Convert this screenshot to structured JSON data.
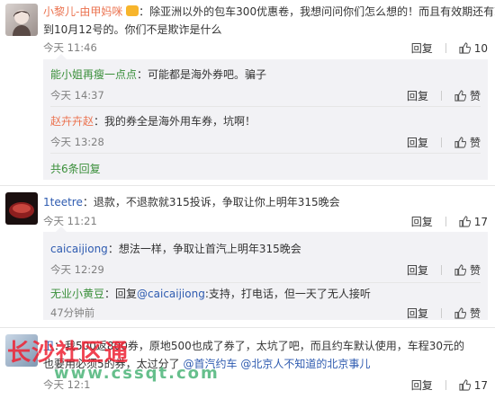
{
  "comments": [
    {
      "name": "小黎儿-由甲妈咪",
      "text_a": "：除亚洲以外的包车300优惠卷，我想问问你们怎么想的！而且有效期还有就",
      "text_b": "到10月12号的。你们不是欺诈是什么",
      "time": "今天 11:46",
      "reply_label": "回复",
      "likes": "10",
      "replies": [
        {
          "name": "能小姐再瘦一点点",
          "text": "：可能都是海外券吧。骗子",
          "time": "今天 14:37",
          "reply_label": "回复",
          "like_label": "赞"
        },
        {
          "name": "赵卉卉赵",
          "text": "：我的券全是海外用车券，坑啊！",
          "time": "今天 13:28",
          "reply_label": "回复",
          "like_label": "赞"
        }
      ],
      "more": "共6条回复"
    },
    {
      "name": "1teetre",
      "text": "：退款，不退款就315投诉，争取让你上明年315晚会",
      "time": "今天 11:21",
      "reply_label": "回复",
      "likes": "17",
      "replies": [
        {
          "name": "caicaijiong",
          "text": "：想法一样，争取让首汽上明年315晚会",
          "time": "今天 12:29",
          "reply_label": "回复",
          "like_label": "赞"
        },
        {
          "name": "无业小黄豆",
          "text_pre": "：回复",
          "mention": "@caicaijiong",
          "text_post": ":支持，打电话，但一天了无人接听",
          "time": "47分钟前",
          "reply_label": "回复",
          "like_label": "赞"
        }
      ]
    },
    {
      "name": "卫",
      "text_a": "：我500返800券，原地500也成了券了，太坑了吧，而且约车默认使用，车程30元的",
      "text_b_pre": "也要用必须5的券，太过分了",
      "mention1": "@首汽约车",
      "mention2": "@北京人不知道的北京事儿",
      "time": "今天 12:1",
      "reply_label": "回复",
      "likes": "17"
    }
  ],
  "watermark": {
    "text": "长沙社区通",
    "url": "www.cssqt.com"
  },
  "colors": {
    "name": "#eb7350",
    "link": "#2e5bb0",
    "reply_bg": "#f2f2f5"
  }
}
